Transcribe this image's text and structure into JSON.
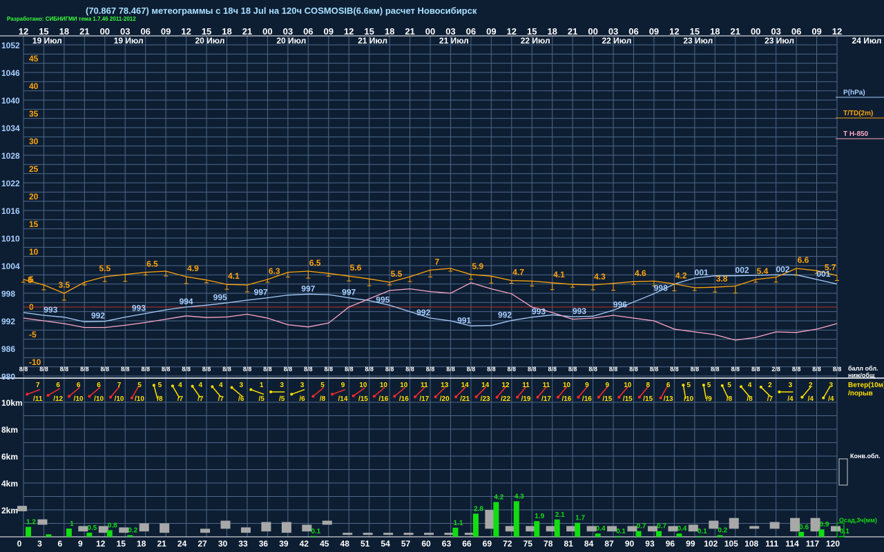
{
  "header": {
    "title": "(70.867 78.467) метеограммы с  18ч 18 Jul на 120ч COSMOSIB(6.6км) расчет Новосибирск",
    "credit": "Разработано: СИБНИГМИ тема 1.7.46 2011-2012"
  },
  "colors": {
    "background": "#0d1e33",
    "grid": "#4f6888",
    "pressure": "#a8cfff",
    "temperature": "#ffa40a",
    "t850": "#ffa8c8",
    "precip": "#11dd11",
    "clouds": "#a8a8a8",
    "wind_strong": "#ff2a2a",
    "wind_weak": "#ffe000",
    "label_white": "#ffffff"
  },
  "chart_data": {
    "type": "line",
    "x": [
      0,
      3,
      6,
      9,
      12,
      15,
      18,
      21,
      24,
      27,
      30,
      33,
      36,
      39,
      42,
      45,
      48,
      51,
      54,
      57,
      60,
      63,
      66,
      69,
      72,
      75,
      78,
      81,
      84,
      87,
      90,
      93,
      96,
      99,
      102,
      105,
      108,
      111,
      114,
      117,
      120
    ],
    "top_hours": [
      "12",
      "15",
      "18",
      "21",
      "00",
      "03",
      "06",
      "09",
      "12",
      "15",
      "18",
      "21",
      "00",
      "03",
      "06",
      "09",
      "12",
      "15",
      "18",
      "21",
      "00",
      "03",
      "06",
      "09",
      "12",
      "15",
      "18",
      "21",
      "00",
      "03",
      "06",
      "09",
      "12",
      "15",
      "18",
      "21",
      "00",
      "03",
      "06",
      "09",
      "12"
    ],
    "date_labels": [
      {
        "hour": 3.5,
        "text": "19 Июл"
      },
      {
        "hour": 15.5,
        "text": "19 Июл"
      },
      {
        "hour": 27.5,
        "text": "20 Июл"
      },
      {
        "hour": 39.5,
        "text": "20 Июл"
      },
      {
        "hour": 51.5,
        "text": "21 Июл"
      },
      {
        "hour": 63.5,
        "text": "21 Июл"
      },
      {
        "hour": 75.5,
        "text": "22 Июл"
      },
      {
        "hour": 87.5,
        "text": "22 Июл"
      },
      {
        "hour": 99.5,
        "text": "23 Июл"
      },
      {
        "hour": 111.5,
        "text": "23 Июл"
      }
    ],
    "date_right": "24 Июл",
    "pressure_ticks": [
      1052,
      1046,
      1040,
      1034,
      1028,
      1022,
      1016,
      1010,
      1004,
      998,
      992,
      986,
      980
    ],
    "temp_ticks": [
      45,
      40,
      35,
      30,
      25,
      20,
      15,
      10,
      5,
      0,
      -5,
      -10
    ],
    "pressure_ylim": [
      980,
      1052
    ],
    "temp_ylim": [
      -10,
      45
    ],
    "legend": {
      "pressure": "P(hPa)",
      "temperature": "T/TD(2m)",
      "t850": "T H-850"
    },
    "series": [
      {
        "name": "P(hPa)",
        "values": [
          993.8,
          993.2,
          992.8,
          991.8,
          991.9,
          992.8,
          993.6,
          994.4,
          995.0,
          995.4,
          995.9,
          996.5,
          997.0,
          997.6,
          997.8,
          997.7,
          997.0,
          996.4,
          995.4,
          994.0,
          992.6,
          992.0,
          990.9,
          991.0,
          992.1,
          992.8,
          993.3,
          992.9,
          993.0,
          994.3,
          996.1,
          997.9,
          1000.0,
          1001.3,
          1001.8,
          1001.8,
          1001.9,
          1002.0,
          1002.0,
          1001.0,
          1000.0
        ]
      },
      {
        "name": "T/TD(2m)",
        "values": [
          5.0,
          4.0,
          2.5,
          4.5,
          5.5,
          5.9,
          6.3,
          6.5,
          5.5,
          4.9,
          4.1,
          4.0,
          5.0,
          6.3,
          6.5,
          6.1,
          5.6,
          5.1,
          4.5,
          5.5,
          6.7,
          7.0,
          5.9,
          5.6,
          4.8,
          4.7,
          4.4,
          4.1,
          4.0,
          4.3,
          4.6,
          4.7,
          4.2,
          3.5,
          3.6,
          3.8,
          5.0,
          5.4,
          7.0,
          6.6,
          5.7
        ]
      },
      {
        "name": "T H-850",
        "values": [
          -2.0,
          -2.5,
          -3.0,
          -3.7,
          -3.7,
          -3.3,
          -2.8,
          -2.2,
          -1.6,
          -1.9,
          -1.8,
          -1.3,
          -2.0,
          -3.2,
          -3.6,
          -2.9,
          0.0,
          1.5,
          3.0,
          3.3,
          2.8,
          2.5,
          4.4,
          3.3,
          2.4,
          0.0,
          -1.0,
          -2.2,
          -2.0,
          -1.5,
          -2.0,
          -2.5,
          -4.0,
          -4.5,
          -5.0,
          -6.0,
          -5.5,
          -4.5,
          -4.6,
          -4.0,
          -3.0
        ]
      }
    ],
    "pressure_labels": [
      {
        "hour": 4,
        "text": "993"
      },
      {
        "hour": 11,
        "text": "992"
      },
      {
        "hour": 17,
        "text": "993"
      },
      {
        "hour": 24,
        "text": "994"
      },
      {
        "hour": 29,
        "text": "995"
      },
      {
        "hour": 35,
        "text": "997"
      },
      {
        "hour": 42,
        "text": "997"
      },
      {
        "hour": 48,
        "text": "997"
      },
      {
        "hour": 53,
        "text": "995"
      },
      {
        "hour": 59,
        "text": "992"
      },
      {
        "hour": 65,
        "text": "991"
      },
      {
        "hour": 71,
        "text": "992"
      },
      {
        "hour": 76,
        "text": "993"
      },
      {
        "hour": 82,
        "text": "993"
      },
      {
        "hour": 88,
        "text": "996"
      },
      {
        "hour": 94,
        "text": "998"
      },
      {
        "hour": 100,
        "text": "001"
      },
      {
        "hour": 106,
        "text": "002"
      },
      {
        "hour": 112,
        "text": "002"
      },
      {
        "hour": 118,
        "text": "001"
      }
    ],
    "temp_labels": [
      {
        "hour": 6,
        "text": "3.5"
      },
      {
        "hour": 12,
        "text": "5.5"
      },
      {
        "hour": 19,
        "text": "6.5"
      },
      {
        "hour": 25,
        "text": "4.9"
      },
      {
        "hour": 31,
        "text": "4.1"
      },
      {
        "hour": 37,
        "text": "6.3"
      },
      {
        "hour": 43,
        "text": "6.5"
      },
      {
        "hour": 49,
        "text": "5.6"
      },
      {
        "hour": 55,
        "text": "5.5"
      },
      {
        "hour": 61,
        "text": "7"
      },
      {
        "hour": 67,
        "text": "5.9"
      },
      {
        "hour": 73,
        "text": "4.7"
      },
      {
        "hour": 79,
        "text": "4.1"
      },
      {
        "hour": 85,
        "text": "4.3"
      },
      {
        "hour": 91,
        "text": "4.6"
      },
      {
        "hour": 97,
        "text": "4.2"
      },
      {
        "hour": 103,
        "text": "3.8"
      },
      {
        "hour": 109,
        "text": "5.4"
      },
      {
        "hour": 115,
        "text": "6.6"
      },
      {
        "hour": 121,
        "text": "5.7"
      }
    ],
    "left_temp_label": "5",
    "cloud_cover": [
      "8/8",
      "8/8",
      "8/8",
      "8/8",
      "8/8",
      "8/8",
      "8/8",
      "8/8",
      "8/8",
      "8/8",
      "8/8",
      "8/8",
      "8/8",
      "8/8",
      "8/8",
      "8/8",
      "8/8",
      "8/8",
      "8/8",
      "8/8",
      "8/8",
      "8/8",
      "8/8",
      "8/8",
      "8/8",
      "8/8",
      "8/8",
      "8/8",
      "8/8",
      "8/8",
      "8/8",
      "8/8",
      "8/8",
      "8/8",
      "8/8",
      "8/8",
      "8/8",
      "2/8",
      "8/8",
      "8/8",
      "8/8"
    ],
    "cloud_cover_caption": [
      "балл обл.",
      "ниж/общ"
    ],
    "wind_speed": [
      7,
      6,
      6,
      6,
      7,
      5,
      5,
      4,
      4,
      4,
      3,
      1,
      3,
      3,
      5,
      9,
      10,
      10,
      10,
      11,
      13,
      14,
      14,
      12,
      11,
      11,
      10,
      9,
      9,
      10,
      8,
      6,
      5,
      5,
      5,
      4,
      2,
      3,
      2,
      3
    ],
    "wind_gust": [
      11,
      12,
      10,
      10,
      10,
      10,
      8,
      7,
      7,
      7,
      6,
      5,
      5,
      6,
      8,
      14,
      15,
      16,
      16,
      17,
      20,
      21,
      23,
      22,
      19,
      17,
      16,
      16,
      15,
      15,
      15,
      13,
      10,
      9,
      8,
      8,
      7,
      4,
      4,
      4
    ],
    "wind_dir": [
      160,
      150,
      140,
      140,
      130,
      120,
      255,
      240,
      235,
      230,
      220,
      200,
      180,
      160,
      140,
      160,
      145,
      140,
      140,
      135,
      135,
      135,
      135,
      130,
      130,
      130,
      130,
      130,
      130,
      130,
      130,
      120,
      260,
      260,
      245,
      230,
      225,
      180,
      130,
      120
    ],
    "wind_caption": [
      "Ветер(10м)",
      "/порыв"
    ],
    "height_ticks": [
      "10km",
      "8km",
      "6km",
      "4km",
      "2km"
    ],
    "cloud_caption": "Конв.обл.",
    "precip_caption": "Осад,3ч(мм)",
    "precip": [
      1.2,
      0.3,
      1.0,
      0.5,
      0.8,
      0.2,
      0,
      0,
      0,
      0,
      0,
      0,
      0,
      0,
      0.1,
      0,
      0,
      0,
      0,
      0,
      0,
      1.1,
      2.8,
      4.2,
      4.3,
      1.9,
      2.1,
      1.7,
      0.4,
      0.1,
      0.7,
      0.7,
      0.4,
      0.1,
      0.2,
      0,
      0,
      0,
      0.6,
      0.9,
      0.1
    ],
    "precip_labels": [
      "1.2",
      "",
      "1",
      "0.5",
      "0.8",
      "0.2",
      "",
      "",
      "",
      "",
      "",
      "",
      "",
      "",
      "0.1",
      "",
      "",
      "",
      "",
      "",
      "",
      "1.1",
      "2.8",
      "4.2",
      "4.3",
      "1.9",
      "2.1",
      "1.7",
      "0.4",
      "0.1",
      "0.7",
      "0.7",
      "0.4",
      "0.1",
      "0.2",
      "",
      "",
      "",
      "0.6",
      "0.9",
      "0.1"
    ],
    "conv_cloud_base": [
      1.9,
      0.9,
      0,
      0.4,
      0.3,
      0.3,
      0.4,
      0.3,
      0,
      0.3,
      0.6,
      0.3,
      0.4,
      0.3,
      0.4,
      0.9,
      0.2,
      0.2,
      0.2,
      0.2,
      0.2,
      0.2,
      0.2,
      0.6,
      0.4,
      0.4,
      0.4,
      0.4,
      0.4,
      0.4,
      0.4,
      0.4,
      0.4,
      0.4,
      0.6,
      0.6,
      0.6,
      0.6,
      0.4,
      0.4,
      0.4
    ],
    "conv_cloud_top": [
      2.3,
      1.3,
      0,
      0.8,
      0.8,
      0.7,
      1.0,
      1.0,
      0,
      0.6,
      1.2,
      0.7,
      1.1,
      1.1,
      0.9,
      1.2,
      0.3,
      0.3,
      0.3,
      0.3,
      0.3,
      0.3,
      0.3,
      2.0,
      0.8,
      0.8,
      0.8,
      0.8,
      0.8,
      0.8,
      0.8,
      0.8,
      0.8,
      0.9,
      1.2,
      1.4,
      0.8,
      1.1,
      1.4,
      1.4,
      0.8
    ],
    "bottom_hours": [
      "0",
      "3",
      "6",
      "9",
      "12",
      "15",
      "18",
      "21",
      "24",
      "27",
      "30",
      "33",
      "36",
      "39",
      "42",
      "45",
      "48",
      "51",
      "54",
      "57",
      "60",
      "63",
      "66",
      "69",
      "72",
      "75",
      "78",
      "81",
      "84",
      "87",
      "90",
      "93",
      "96",
      "99",
      "102",
      "105",
      "108",
      "111",
      "114",
      "117",
      "120"
    ]
  }
}
